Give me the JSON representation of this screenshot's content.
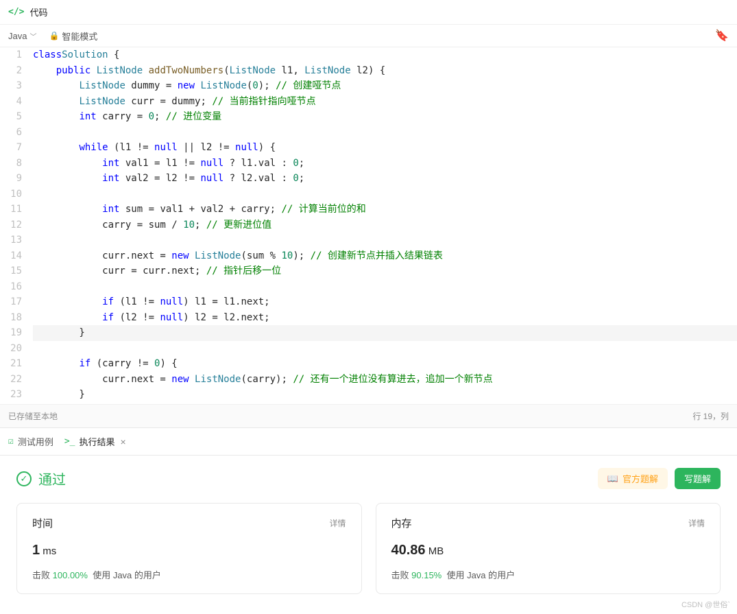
{
  "header": {
    "title": "代码"
  },
  "toolbar": {
    "lang": "Java",
    "mode": "智能模式"
  },
  "gutter": [
    "1",
    "2",
    "3",
    "4",
    "5",
    "6",
    "7",
    "8",
    "9",
    "10",
    "11",
    "12",
    "13",
    "14",
    "15",
    "16",
    "17",
    "18",
    "19",
    "20",
    "21",
    "22",
    "23"
  ],
  "active_line_index": 18,
  "status": {
    "saved": "已存储至本地",
    "pos": "行 19，列 "
  },
  "tabs": {
    "test": "测试用例",
    "result": "执行结果"
  },
  "result": {
    "pass": "通过",
    "solution_btn": "官方题解",
    "write_btn": "写题解"
  },
  "cards": {
    "time": {
      "title": "时间",
      "detail": "详情",
      "value": "1",
      "unit": "ms",
      "beat_prefix": "击败",
      "beat_pct": "100.00%",
      "beat_suffix": "使用 Java 的用户"
    },
    "mem": {
      "title": "内存",
      "detail": "详情",
      "value": "40.86",
      "unit": "MB",
      "beat_prefix": "击败",
      "beat_pct": "90.15%",
      "beat_suffix": "使用 Java 的用户"
    }
  },
  "watermark": "CSDN @世俗`",
  "code": [
    [
      [
        "kw",
        "class"
      ],
      [
        "",
        ""
      ],
      [
        "type",
        "Solution"
      ],
      [
        "",
        " {"
      ]
    ],
    [
      [
        "",
        "    "
      ],
      [
        "kw",
        "public"
      ],
      [
        "",
        " "
      ],
      [
        "type",
        "ListNode"
      ],
      [
        "",
        " "
      ],
      [
        "func",
        "addTwoNumbers"
      ],
      [
        "",
        "("
      ],
      [
        "type",
        "ListNode"
      ],
      [
        "",
        " l1, "
      ],
      [
        "type",
        "ListNode"
      ],
      [
        "",
        " l2) {"
      ]
    ],
    [
      [
        "",
        "        "
      ],
      [
        "type",
        "ListNode"
      ],
      [
        "",
        " dummy = "
      ],
      [
        "kw",
        "new"
      ],
      [
        "",
        " "
      ],
      [
        "type",
        "ListNode"
      ],
      [
        "",
        "("
      ],
      [
        "num",
        "0"
      ],
      [
        "",
        "); "
      ],
      [
        "cm",
        "// 创建哑节点"
      ]
    ],
    [
      [
        "",
        "        "
      ],
      [
        "type",
        "ListNode"
      ],
      [
        "",
        " curr = dummy; "
      ],
      [
        "cm",
        "// 当前指针指向哑节点"
      ]
    ],
    [
      [
        "",
        "        "
      ],
      [
        "kw",
        "int"
      ],
      [
        "",
        " carry = "
      ],
      [
        "num",
        "0"
      ],
      [
        "",
        "; "
      ],
      [
        "cm",
        "// 进位变量"
      ]
    ],
    [
      [
        "",
        ""
      ]
    ],
    [
      [
        "",
        "        "
      ],
      [
        "kw",
        "while"
      ],
      [
        "",
        " (l1 != "
      ],
      [
        "kw",
        "null"
      ],
      [
        "",
        " || l2 != "
      ],
      [
        "kw",
        "null"
      ],
      [
        "",
        ") {"
      ]
    ],
    [
      [
        "",
        "            "
      ],
      [
        "kw",
        "int"
      ],
      [
        "",
        " val1 = l1 != "
      ],
      [
        "kw",
        "null"
      ],
      [
        "",
        " ? l1.val : "
      ],
      [
        "num",
        "0"
      ],
      [
        "",
        ";"
      ]
    ],
    [
      [
        "",
        "            "
      ],
      [
        "kw",
        "int"
      ],
      [
        "",
        " val2 = l2 != "
      ],
      [
        "kw",
        "null"
      ],
      [
        "",
        " ? l2.val : "
      ],
      [
        "num",
        "0"
      ],
      [
        "",
        ";"
      ]
    ],
    [
      [
        "",
        ""
      ]
    ],
    [
      [
        "",
        "            "
      ],
      [
        "kw",
        "int"
      ],
      [
        "",
        " sum = val1 + val2 + carry; "
      ],
      [
        "cm",
        "// 计算当前位的和"
      ]
    ],
    [
      [
        "",
        "            carry = sum / "
      ],
      [
        "num",
        "10"
      ],
      [
        "",
        "; "
      ],
      [
        "cm",
        "// 更新进位值"
      ]
    ],
    [
      [
        "",
        ""
      ]
    ],
    [
      [
        "",
        "            curr.next = "
      ],
      [
        "kw",
        "new"
      ],
      [
        "",
        " "
      ],
      [
        "type",
        "ListNode"
      ],
      [
        "",
        "(sum % "
      ],
      [
        "num",
        "10"
      ],
      [
        "",
        "); "
      ],
      [
        "cm",
        "// 创建新节点并插入结果链表"
      ]
    ],
    [
      [
        "",
        "            curr = curr.next; "
      ],
      [
        "cm",
        "// 指针后移一位"
      ]
    ],
    [
      [
        "",
        ""
      ]
    ],
    [
      [
        "",
        "            "
      ],
      [
        "kw",
        "if"
      ],
      [
        "",
        " (l1 != "
      ],
      [
        "kw",
        "null"
      ],
      [
        "",
        ") l1 = l1.next;"
      ]
    ],
    [
      [
        "",
        "            "
      ],
      [
        "kw",
        "if"
      ],
      [
        "",
        " (l2 != "
      ],
      [
        "kw",
        "null"
      ],
      [
        "",
        ") l2 = l2.next;"
      ]
    ],
    [
      [
        "",
        "        }"
      ]
    ],
    [
      [
        "",
        ""
      ]
    ],
    [
      [
        "",
        "        "
      ],
      [
        "kw",
        "if"
      ],
      [
        "",
        " (carry != "
      ],
      [
        "num",
        "0"
      ],
      [
        "",
        ") {"
      ]
    ],
    [
      [
        "",
        "            curr.next = "
      ],
      [
        "kw",
        "new"
      ],
      [
        "",
        " "
      ],
      [
        "type",
        "ListNode"
      ],
      [
        "",
        "(carry); "
      ],
      [
        "cm",
        "// 还有一个进位没有算进去，追加一个新节点"
      ]
    ],
    [
      [
        "",
        "        }"
      ]
    ]
  ]
}
